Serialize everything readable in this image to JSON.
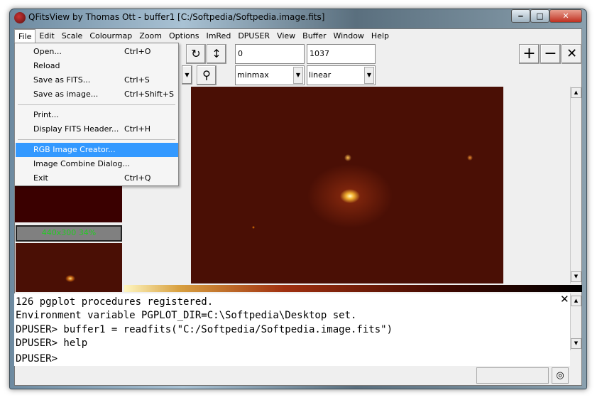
{
  "window": {
    "title": "QFitsView by Thomas Ott - buffer1 [C:/Softpedia/Softpedia.image.fits]",
    "minimize": "‒",
    "maximize": "□",
    "close": "✕"
  },
  "menubar": [
    "File",
    "Edit",
    "Scale",
    "Colourmap",
    "Zoom",
    "Options",
    "ImRed",
    "DPUSER",
    "View",
    "Buffer",
    "Window",
    "Help"
  ],
  "file_menu": [
    {
      "label": "Open...",
      "shortcut": "Ctrl+O"
    },
    {
      "label": "Reload",
      "shortcut": ""
    },
    {
      "label": "Save as FITS...",
      "shortcut": "Ctrl+S"
    },
    {
      "label": "Save as image...",
      "shortcut": "Ctrl+Shift+S"
    },
    {
      "label": "Print...",
      "shortcut": ""
    },
    {
      "label": "Display FITS Header...",
      "shortcut": "Ctrl+H"
    },
    {
      "label": "RGB Image Creator...",
      "shortcut": ""
    },
    {
      "label": "Image Combine Dialog...",
      "shortcut": ""
    },
    {
      "label": "Exit",
      "shortcut": "Ctrl+Q"
    }
  ],
  "toolbar": {
    "rotate": "↻",
    "flip": "↕",
    "min_value": "0",
    "max_value": "1037",
    "scale_mode": "minmax",
    "scale_type": "linear",
    "zoom_in": "+",
    "zoom_out": "−",
    "close": "✕"
  },
  "thumbnail": {
    "label": "440x300  34%"
  },
  "console": {
    "lines": [
      "126 pgplot procedures registered.",
      "Environment variable PGPLOT_DIR=C:\\Softpedia\\Desktop set.",
      "DPUSER> buffer1 = readfits(\"C:/Softpedia/Softpedia.image.fits\")",
      "DPUSER> help",
      "",
      "DPUSER>"
    ],
    "close": "✕"
  }
}
